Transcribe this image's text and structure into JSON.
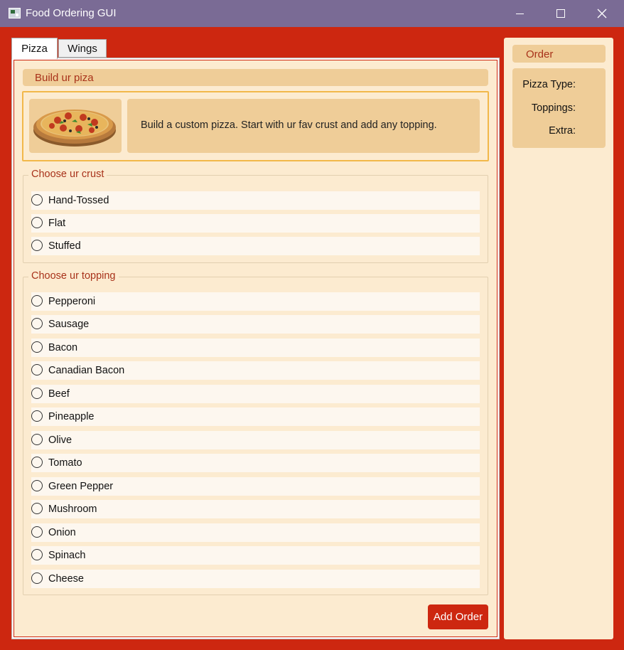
{
  "window": {
    "title": "Food Ordering GUI"
  },
  "tabs": [
    {
      "label": "Pizza",
      "active": true
    },
    {
      "label": "Wings",
      "active": false
    }
  ],
  "pizza": {
    "header": "Build ur piza",
    "intro_text": "Build a custom pizza. Start with ur fav crust and add any topping.",
    "crust_group_label": "Choose ur crust",
    "crust_options": [
      "Hand-Tossed",
      "Flat",
      "Stuffed"
    ],
    "topping_group_label": "Choose ur topping",
    "topping_options": [
      "Pepperoni",
      "Sausage",
      "Bacon",
      "Canadian Bacon",
      "Beef",
      "Pineapple",
      "Olive",
      "Tomato",
      "Green Pepper",
      "Mushroom",
      "Onion",
      "Spinach",
      "Cheese"
    ],
    "add_button": "Add Order"
  },
  "order": {
    "header": "Order",
    "pizza_type_label": "Pizza Type:",
    "toppings_label": "Toppings:",
    "extra_label": "Extra:"
  },
  "colors": {
    "accent_red": "#cd2710",
    "titlebar": "#7a6b95",
    "panel_bg": "#fcebd0",
    "header_bg": "#efcd98",
    "highlight_border": "#f2b84a"
  }
}
